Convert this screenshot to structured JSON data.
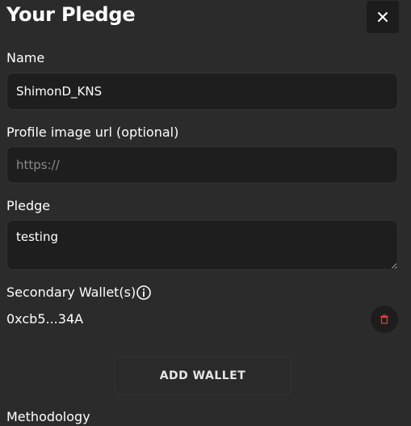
{
  "header": {
    "title": "Your Pledge",
    "close_icon": "close-icon"
  },
  "form": {
    "name": {
      "label": "Name",
      "value": "ShimonD_KNS"
    },
    "profile_image": {
      "label": "Profile image url (optional)",
      "placeholder": "https://"
    },
    "pledge": {
      "label": "Pledge",
      "value": "testing"
    },
    "secondary_wallets": {
      "label": "Secondary Wallet(s)",
      "info_icon": "info-icon",
      "wallets": [
        {
          "address": "0xcb5...34A",
          "delete_icon": "trash-icon"
        }
      ],
      "add_button_label": "ADD WALLET"
    },
    "methodology": {
      "label": "Methodology"
    }
  },
  "colors": {
    "background": "#2b2b2b",
    "field_background": "#1e1e1e",
    "delete_icon": "#e0403a"
  }
}
